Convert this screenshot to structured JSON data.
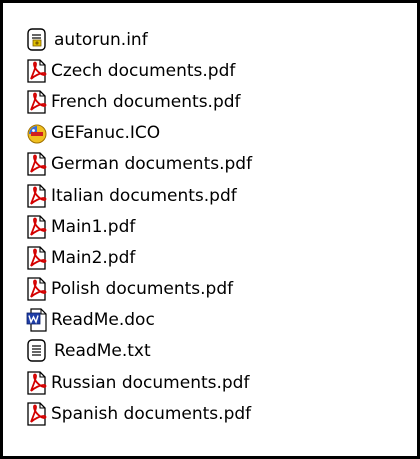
{
  "files": [
    {
      "name": "autorun.inf",
      "icon": "inf-file-icon"
    },
    {
      "name": "Czech documents.pdf",
      "icon": "pdf-file-icon"
    },
    {
      "name": "French documents.pdf",
      "icon": "pdf-file-icon"
    },
    {
      "name": "GEFanuc.ICO",
      "icon": "ico-file-icon"
    },
    {
      "name": "German documents.pdf",
      "icon": "pdf-file-icon"
    },
    {
      "name": "Italian documents.pdf",
      "icon": "pdf-file-icon"
    },
    {
      "name": "Main1.pdf",
      "icon": "pdf-file-icon"
    },
    {
      "name": "Main2.pdf",
      "icon": "pdf-file-icon"
    },
    {
      "name": "Polish documents.pdf",
      "icon": "pdf-file-icon"
    },
    {
      "name": "ReadMe.doc",
      "icon": "word-doc-icon"
    },
    {
      "name": "ReadMe.txt",
      "icon": "text-file-icon"
    },
    {
      "name": "Russian documents.pdf",
      "icon": "pdf-file-icon"
    },
    {
      "name": "Spanish documents.pdf",
      "icon": "pdf-file-icon"
    }
  ],
  "colors": {
    "pdf_red": "#d40000",
    "frame": "#000000",
    "background": "#ffffff"
  }
}
